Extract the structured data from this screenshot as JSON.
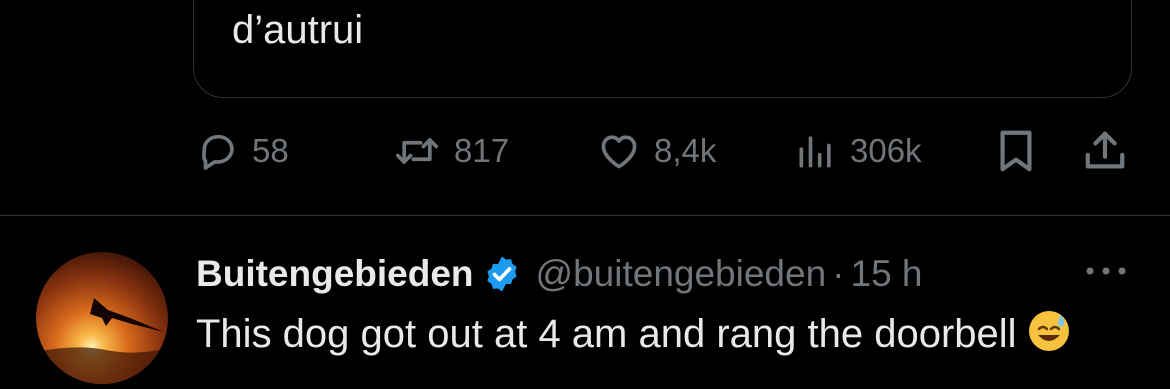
{
  "quoted_tweet": {
    "text": "d’autrui"
  },
  "actions": {
    "reply": {
      "icon": "reply-icon",
      "count": "58"
    },
    "retweet": {
      "icon": "retweet-icon",
      "count": "817"
    },
    "like": {
      "icon": "heart-icon",
      "count": "8,4k"
    },
    "views": {
      "icon": "views-icon",
      "count": "306k"
    },
    "bookmark": {
      "icon": "bookmark-icon"
    },
    "share": {
      "icon": "share-icon"
    }
  },
  "next_tweet": {
    "display_name": "Buitengebieden",
    "verified": true,
    "handle": "@buitengebieden",
    "separator": "·",
    "time": "15 h",
    "text": "This dog got out at 4 am and rang the doorbell",
    "emoji": "😅",
    "more_icon": "more-icon"
  },
  "colors": {
    "background": "#000000",
    "primary_text": "#e7e9ea",
    "secondary_text": "#71767b",
    "divider": "#2f3336",
    "verified_badge": "#1d9bf0"
  }
}
